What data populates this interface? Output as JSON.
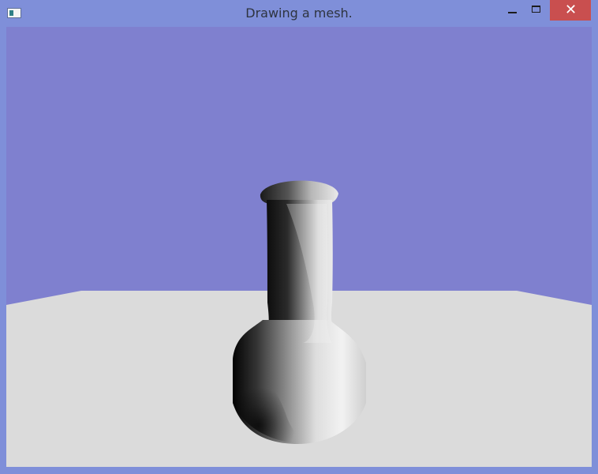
{
  "window": {
    "title": "Drawing a mesh.",
    "controls": {
      "minimize_icon": "minimize-icon",
      "maximize_icon": "maximize-icon",
      "close_icon": "close-icon",
      "close_label": "✕"
    }
  },
  "scene": {
    "background_color": "#7f80cf",
    "floor_color": "#dbdbdb",
    "object": "vase"
  }
}
